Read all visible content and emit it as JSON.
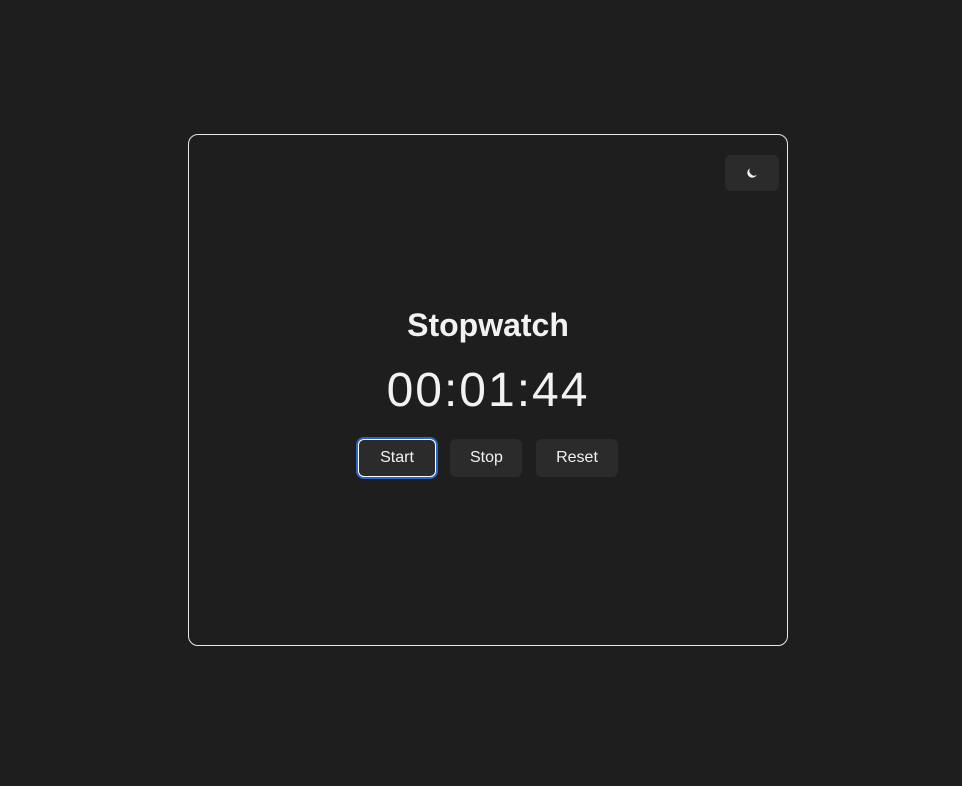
{
  "app": {
    "title": "Stopwatch",
    "time": "00:01:44"
  },
  "theme_toggle": {
    "icon": "moon-icon"
  },
  "controls": {
    "start_label": "Start",
    "stop_label": "Stop",
    "reset_label": "Reset"
  },
  "colors": {
    "background": "#1e1e1e",
    "button_bg": "#2b2b2b",
    "text": "#f2f2f2",
    "focus_ring": "#2b66c7"
  }
}
